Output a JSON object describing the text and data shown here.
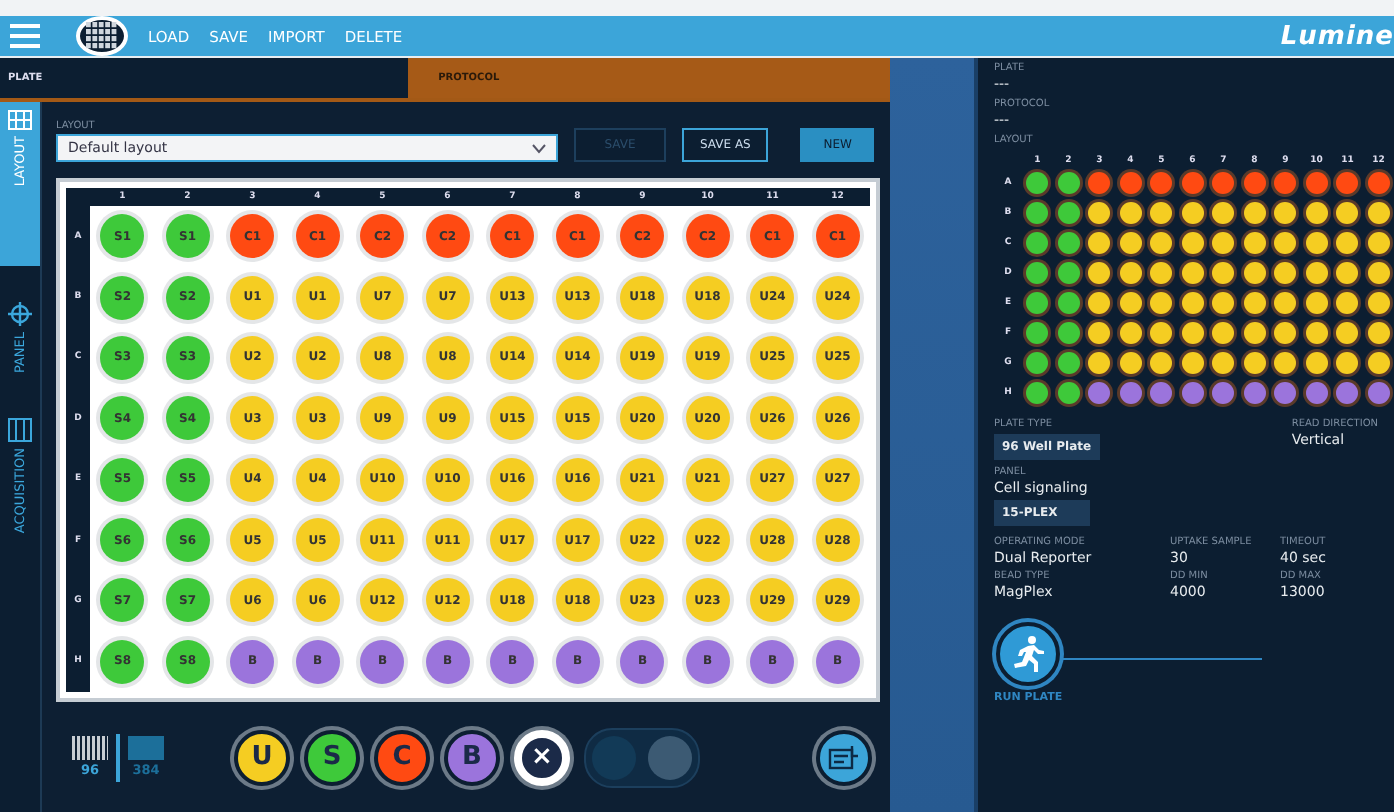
{
  "menu": {
    "items": [
      "LOAD",
      "SAVE",
      "IMPORT",
      "DELETE"
    ],
    "logo": "Lumine"
  },
  "tabs": [
    {
      "label": "PLATE",
      "selected": false
    },
    {
      "label": "PROTOCOL",
      "selected": true
    }
  ],
  "sidebar": {
    "items": [
      {
        "label": "LAYOUT",
        "selected": true,
        "kind": "layout"
      },
      {
        "label": "PANEL",
        "selected": false,
        "kind": "panel"
      },
      {
        "label": "ACQUISITION",
        "selected": false,
        "kind": "acquisition"
      }
    ]
  },
  "layout_bar": {
    "label": "LAYOUT",
    "value": "Default layout",
    "buttons": [
      {
        "label": "SAVE",
        "disabled": true,
        "kind": "outline"
      },
      {
        "label": "SAVE AS",
        "disabled": false,
        "kind": "outline"
      },
      {
        "label": "NEW",
        "disabled": false,
        "kind": "filled"
      }
    ]
  },
  "plate": {
    "columns": [
      "1",
      "2",
      "3",
      "4",
      "5",
      "6",
      "7",
      "8",
      "9",
      "10",
      "11",
      "12"
    ],
    "rows": [
      {
        "label": "A",
        "wells": [
          {
            "label": "S1",
            "kind": "S"
          },
          {
            "label": "S1",
            "kind": "S"
          },
          {
            "label": "C1",
            "kind": "C"
          },
          {
            "label": "C1",
            "kind": "C"
          },
          {
            "label": "C2",
            "kind": "C"
          },
          {
            "label": "C2",
            "kind": "C"
          },
          {
            "label": "C1",
            "kind": "C"
          },
          {
            "label": "C1",
            "kind": "C"
          },
          {
            "label": "C2",
            "kind": "C"
          },
          {
            "label": "C2",
            "kind": "C"
          },
          {
            "label": "C1",
            "kind": "C"
          },
          {
            "label": "C1",
            "kind": "C"
          }
        ]
      },
      {
        "label": "B",
        "wells": [
          {
            "label": "S2",
            "kind": "S"
          },
          {
            "label": "S2",
            "kind": "S"
          },
          {
            "label": "U1",
            "kind": "U"
          },
          {
            "label": "U1",
            "kind": "U"
          },
          {
            "label": "U7",
            "kind": "U"
          },
          {
            "label": "U7",
            "kind": "U"
          },
          {
            "label": "U13",
            "kind": "U"
          },
          {
            "label": "U13",
            "kind": "U"
          },
          {
            "label": "U18",
            "kind": "U"
          },
          {
            "label": "U18",
            "kind": "U"
          },
          {
            "label": "U24",
            "kind": "U"
          },
          {
            "label": "U24",
            "kind": "U"
          }
        ]
      },
      {
        "label": "C",
        "wells": [
          {
            "label": "S3",
            "kind": "S"
          },
          {
            "label": "S3",
            "kind": "S"
          },
          {
            "label": "U2",
            "kind": "U"
          },
          {
            "label": "U2",
            "kind": "U"
          },
          {
            "label": "U8",
            "kind": "U"
          },
          {
            "label": "U8",
            "kind": "U"
          },
          {
            "label": "U14",
            "kind": "U"
          },
          {
            "label": "U14",
            "kind": "U"
          },
          {
            "label": "U19",
            "kind": "U"
          },
          {
            "label": "U19",
            "kind": "U"
          },
          {
            "label": "U25",
            "kind": "U"
          },
          {
            "label": "U25",
            "kind": "U"
          }
        ]
      },
      {
        "label": "D",
        "wells": [
          {
            "label": "S4",
            "kind": "S"
          },
          {
            "label": "S4",
            "kind": "S"
          },
          {
            "label": "U3",
            "kind": "U"
          },
          {
            "label": "U3",
            "kind": "U"
          },
          {
            "label": "U9",
            "kind": "U"
          },
          {
            "label": "U9",
            "kind": "U"
          },
          {
            "label": "U15",
            "kind": "U"
          },
          {
            "label": "U15",
            "kind": "U"
          },
          {
            "label": "U20",
            "kind": "U"
          },
          {
            "label": "U20",
            "kind": "U"
          },
          {
            "label": "U26",
            "kind": "U"
          },
          {
            "label": "U26",
            "kind": "U"
          }
        ]
      },
      {
        "label": "E",
        "wells": [
          {
            "label": "S5",
            "kind": "S"
          },
          {
            "label": "S5",
            "kind": "S"
          },
          {
            "label": "U4",
            "kind": "U"
          },
          {
            "label": "U4",
            "kind": "U"
          },
          {
            "label": "U10",
            "kind": "U"
          },
          {
            "label": "U10",
            "kind": "U"
          },
          {
            "label": "U16",
            "kind": "U"
          },
          {
            "label": "U16",
            "kind": "U"
          },
          {
            "label": "U21",
            "kind": "U"
          },
          {
            "label": "U21",
            "kind": "U"
          },
          {
            "label": "U27",
            "kind": "U"
          },
          {
            "label": "U27",
            "kind": "U"
          }
        ]
      },
      {
        "label": "F",
        "wells": [
          {
            "label": "S6",
            "kind": "S"
          },
          {
            "label": "S6",
            "kind": "S"
          },
          {
            "label": "U5",
            "kind": "U"
          },
          {
            "label": "U5",
            "kind": "U"
          },
          {
            "label": "U11",
            "kind": "U"
          },
          {
            "label": "U11",
            "kind": "U"
          },
          {
            "label": "U17",
            "kind": "U"
          },
          {
            "label": "U17",
            "kind": "U"
          },
          {
            "label": "U22",
            "kind": "U"
          },
          {
            "label": "U22",
            "kind": "U"
          },
          {
            "label": "U28",
            "kind": "U"
          },
          {
            "label": "U28",
            "kind": "U"
          }
        ]
      },
      {
        "label": "G",
        "wells": [
          {
            "label": "S7",
            "kind": "S"
          },
          {
            "label": "S7",
            "kind": "S"
          },
          {
            "label": "U6",
            "kind": "U"
          },
          {
            "label": "U6",
            "kind": "U"
          },
          {
            "label": "U12",
            "kind": "U"
          },
          {
            "label": "U12",
            "kind": "U"
          },
          {
            "label": "U18",
            "kind": "U"
          },
          {
            "label": "U18",
            "kind": "U"
          },
          {
            "label": "U23",
            "kind": "U"
          },
          {
            "label": "U23",
            "kind": "U"
          },
          {
            "label": "U29",
            "kind": "U"
          },
          {
            "label": "U29",
            "kind": "U"
          }
        ]
      },
      {
        "label": "H",
        "wells": [
          {
            "label": "S8",
            "kind": "S"
          },
          {
            "label": "S8",
            "kind": "S"
          },
          {
            "label": "B",
            "kind": "B"
          },
          {
            "label": "B",
            "kind": "B"
          },
          {
            "label": "B",
            "kind": "B"
          },
          {
            "label": "B",
            "kind": "B"
          },
          {
            "label": "B",
            "kind": "B"
          },
          {
            "label": "B",
            "kind": "B"
          },
          {
            "label": "B",
            "kind": "B"
          },
          {
            "label": "B",
            "kind": "B"
          },
          {
            "label": "B",
            "kind": "B"
          },
          {
            "label": "B",
            "kind": "B"
          }
        ]
      }
    ]
  },
  "toolbar": {
    "plate_sizes": [
      {
        "label": "96",
        "selected": true
      },
      {
        "label": "384",
        "selected": false
      }
    ],
    "well_tools": [
      {
        "label": "U",
        "kind": "U"
      },
      {
        "label": "S",
        "kind": "S"
      },
      {
        "label": "C",
        "kind": "C"
      },
      {
        "label": "B",
        "kind": "B"
      },
      {
        "label": "×",
        "kind": "clear"
      }
    ],
    "mode_toggle": {
      "disabled": true
    }
  },
  "summary": {
    "plate": {
      "label": "PLATE",
      "value": "---"
    },
    "protocol": {
      "label": "PROTOCOL",
      "value": "---"
    },
    "layout": {
      "label": "LAYOUT",
      "columns": [
        "1",
        "2",
        "3",
        "4",
        "5",
        "6",
        "7",
        "8",
        "9",
        "10",
        "11",
        "12"
      ],
      "rows": [
        "A",
        "B",
        "C",
        "D",
        "E",
        "F",
        "G",
        "H"
      ]
    },
    "plate_type": {
      "label": "PLATE TYPE",
      "value": "96 Well Plate"
    },
    "read_direction": {
      "label": "READ DIRECTION",
      "value": "Vertical"
    },
    "panel": {
      "label": "PANEL",
      "value": "Cell signaling",
      "badge": "15-PLEX"
    },
    "fields": [
      {
        "label": "OPERATING MODE",
        "value": "Dual Reporter"
      },
      {
        "label": "UPTAKE SAMPLE",
        "value": "30"
      },
      {
        "label": "TIMEOUT",
        "value": "40 sec"
      },
      {
        "label": "BEAD TYPE",
        "value": "MagPlex"
      },
      {
        "label": "DD MIN",
        "value": "4000"
      },
      {
        "label": "DD MAX",
        "value": "13000"
      }
    ],
    "run_button": "RUN PLATE"
  }
}
